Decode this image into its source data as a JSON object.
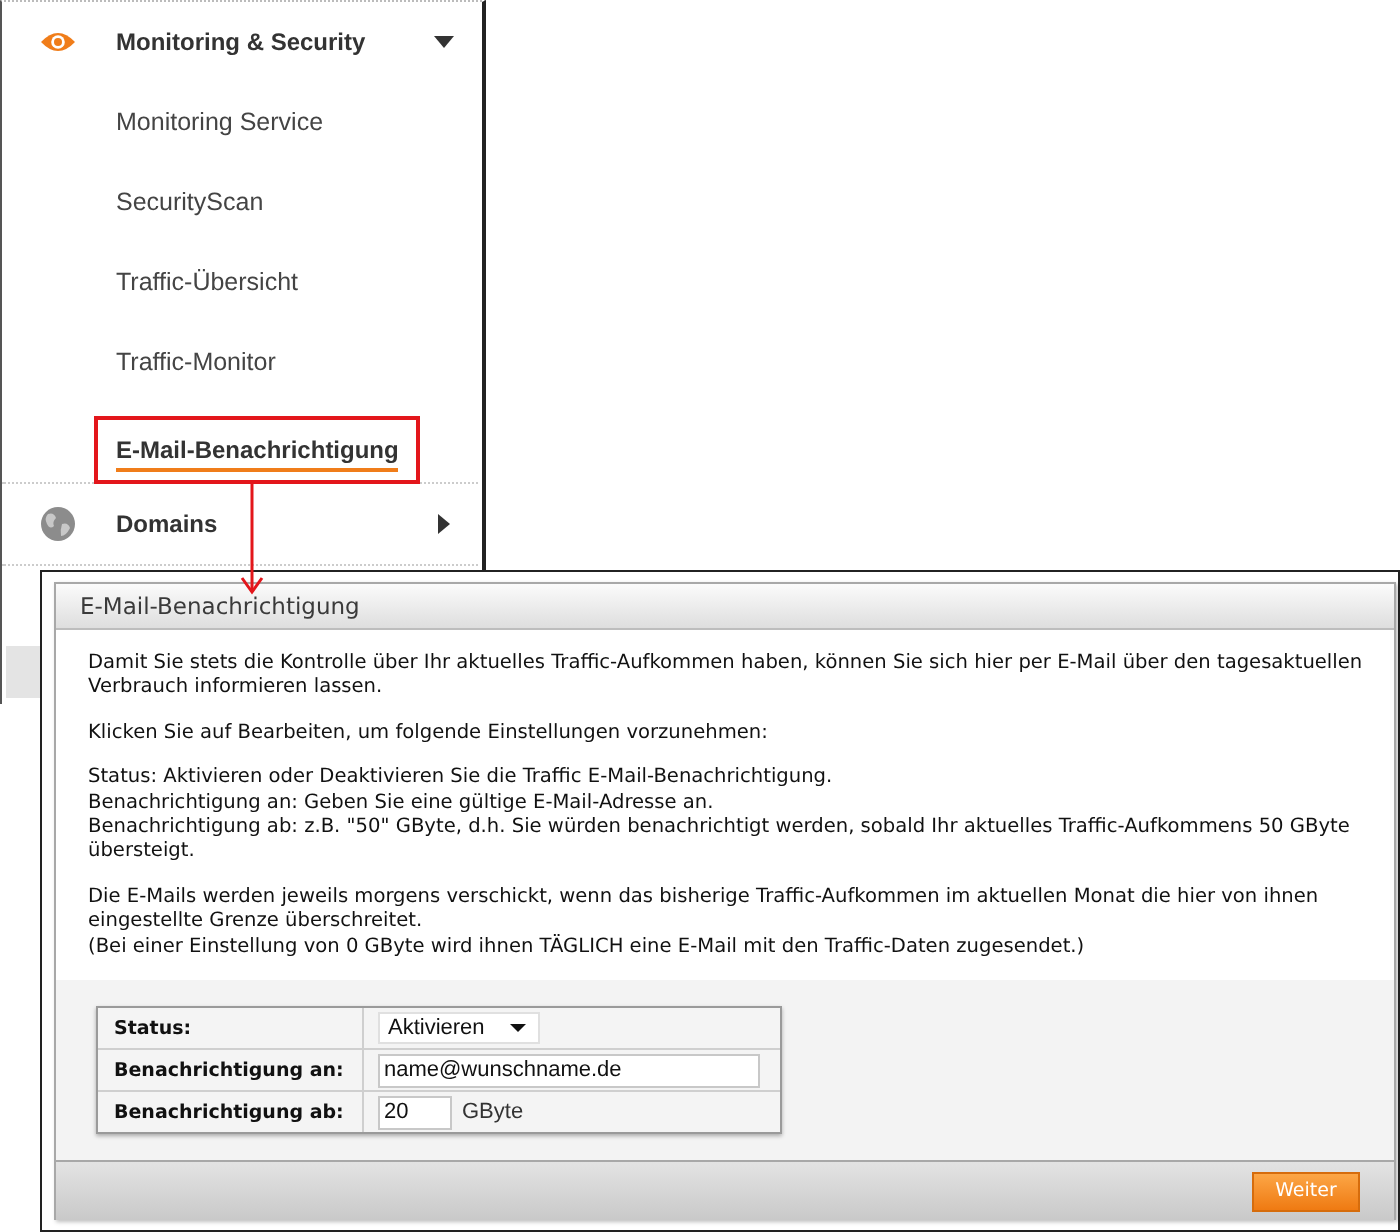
{
  "sidebar": {
    "sections": [
      {
        "label": "Monitoring & Security",
        "expanded": true,
        "items": [
          {
            "label": "Monitoring Service",
            "selected": false,
            "marked": false
          },
          {
            "label": "SecurityScan",
            "selected": false,
            "marked": false
          },
          {
            "label": "Traffic-Übersicht",
            "selected": false,
            "marked": false
          },
          {
            "label": "Traffic-Monitor",
            "selected": false,
            "marked": false
          },
          {
            "label": "E-Mail-Benachrichtigung",
            "selected": true,
            "marked": true
          }
        ]
      },
      {
        "label": "Domains",
        "expanded": false
      }
    ]
  },
  "panel": {
    "title": "E-Mail-Benachrichtigung",
    "paragraphs": [
      [
        "Damit Sie stets die Kontrolle über Ihr aktuelles Traffic-Aufkommen haben, können Sie sich hier per E-Mail über den tagesaktuellen Verbrauch informieren lassen."
      ],
      [
        "Klicken Sie auf Bearbeiten, um folgende Einstellungen vorzunehmen:"
      ],
      [
        "Status: Aktivieren oder Deaktivieren Sie die Traffic E-Mail-Benachrichtigung.",
        "Benachrichtigung an: Geben Sie eine gültige E-Mail-Adresse an.",
        "Benachrichtigung ab: z.B. \"50\" GByte, d.h. Sie würden benachrichtigt werden, sobald Ihr aktuelles Traffic-Aufkommens 50 GByte übersteigt."
      ],
      [
        "Die E-Mails werden jeweils morgens verschickt, wenn das bisherige Traffic-Aufkommen im aktuellen Monat die hier von ihnen eingestellte Grenze überschreitet.",
        "(Bei einer Einstellung von 0 GByte wird ihnen TÄGLICH eine E-Mail mit den Traffic-Daten zugesendet.)"
      ]
    ],
    "form": [
      {
        "kind": "select",
        "label": "Status:",
        "value": "Aktivieren"
      },
      {
        "kind": "text",
        "label": "Benachrichtigung an:",
        "value": "name@wunschname.de"
      },
      {
        "kind": "number",
        "label": "Benachrichtigung ab:",
        "value": "20",
        "unit": "GByte"
      }
    ],
    "buttons": [
      {
        "label": "Weiter"
      }
    ]
  }
}
